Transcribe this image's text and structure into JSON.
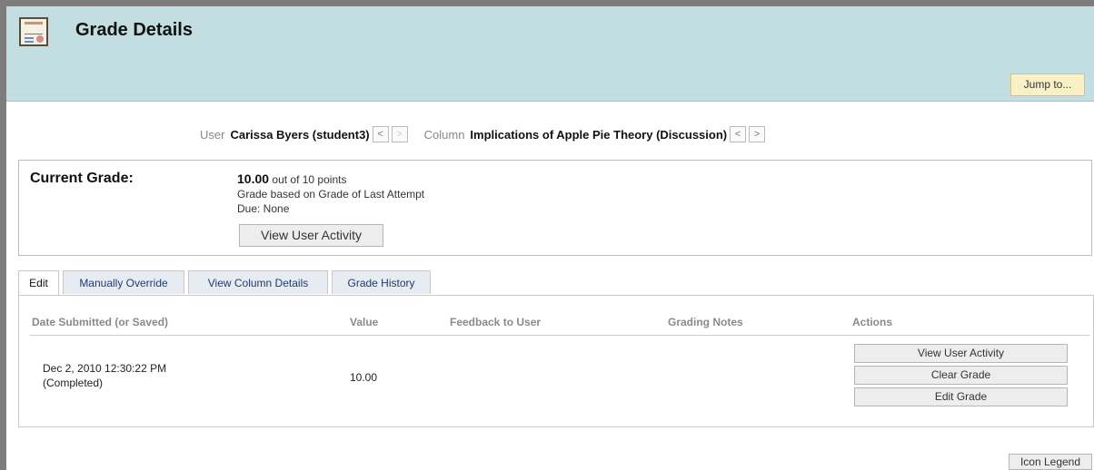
{
  "header": {
    "title": "Grade Details",
    "logo_text": "Certificate",
    "jump_label": "Jump to...",
    "background": "#c2dee0"
  },
  "navigator": {
    "user_label": "User",
    "user_value": "Carissa Byers (student3)",
    "column_label": "Column",
    "column_value": "Implications of Apple Pie Theory (Discussion)",
    "prev_symbol": "<",
    "next_symbol": ">"
  },
  "current_grade": {
    "label": "Current Grade:",
    "score": "10.00",
    "out_of": "out of 10 points",
    "basis": "Grade based on Grade of Last Attempt",
    "due": "Due: None",
    "view_activity_label": "View User Activity"
  },
  "tabs": [
    {
      "label": "Edit",
      "active": true
    },
    {
      "label": "Manually Override",
      "active": false
    },
    {
      "label": "View Column Details",
      "active": false
    },
    {
      "label": "Grade History",
      "active": false
    }
  ],
  "table": {
    "headers": [
      "Date Submitted (or Saved)",
      "Value",
      "Feedback to User",
      "Grading Notes",
      "Actions"
    ],
    "rows": [
      {
        "date": "Dec 2, 2010 12:30:22 PM",
        "status": "(Completed)",
        "value": "10.00",
        "feedback": "",
        "notes": "",
        "actions": [
          "View User Activity",
          "Clear Grade",
          "Edit Grade"
        ]
      }
    ]
  },
  "footer": {
    "legend_label": "Icon Legend"
  }
}
